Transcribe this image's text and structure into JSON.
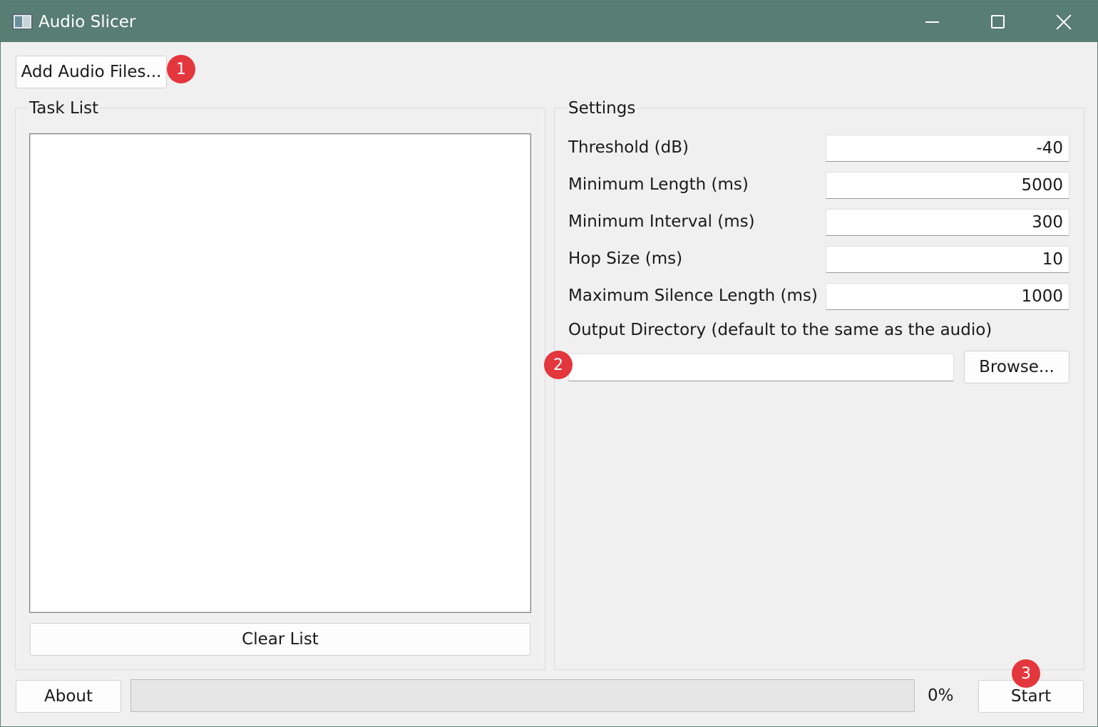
{
  "window": {
    "title": "Audio Slicer",
    "icons": {
      "app": "app-icon",
      "minimize": "minimize-icon",
      "maximize": "maximize-icon",
      "close": "close-icon"
    }
  },
  "toolbar": {
    "add_files_label": "Add Audio Files..."
  },
  "task_list": {
    "title": "Task List",
    "items": [],
    "clear_label": "Clear List"
  },
  "settings": {
    "title": "Settings",
    "fields": [
      {
        "label": "Threshold (dB)",
        "value": "-40"
      },
      {
        "label": "Minimum Length (ms)",
        "value": "5000"
      },
      {
        "label": "Minimum Interval (ms)",
        "value": "300"
      },
      {
        "label": "Hop Size (ms)",
        "value": "10"
      },
      {
        "label": "Maximum Silence Length (ms)",
        "value": "1000"
      }
    ],
    "output_dir_label": "Output Directory (default to the same as the audio)",
    "output_dir_value": "",
    "browse_label": "Browse..."
  },
  "footer": {
    "about_label": "About",
    "progress_fraction": 0,
    "progress_text": "0%",
    "start_label": "Start"
  },
  "markers": [
    "1",
    "2",
    "3"
  ],
  "colors": {
    "titlebar": "#587d73",
    "marker": "#e4363d",
    "progress_fill": "#06b025"
  }
}
